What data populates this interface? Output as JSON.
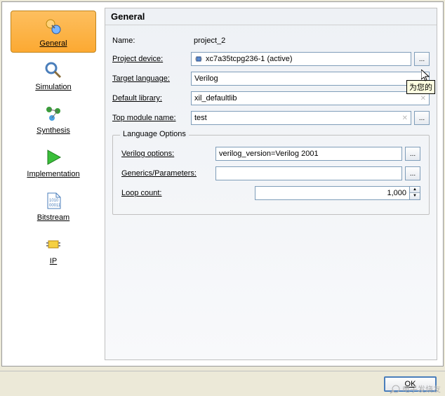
{
  "sidebar": {
    "items": [
      {
        "label": "General"
      },
      {
        "label": "Simulation"
      },
      {
        "label": "Synthesis"
      },
      {
        "label": "Implementation"
      },
      {
        "label": "Bitstream"
      },
      {
        "label": "IP"
      }
    ]
  },
  "panel": {
    "title": "General",
    "name_label": "Name:",
    "name_value": "project_2",
    "device_label": "Project device:",
    "device_value": "xc7a35tcpg236-1 (active)",
    "target_label": "Target language:",
    "target_value": "Verilog",
    "lib_label": "Default library:",
    "lib_value": "xil_defaultlib",
    "top_label": "Top module name:",
    "top_value": "test",
    "lang_options_legend": "Language Options",
    "verilog_opts_label": "Verilog options:",
    "verilog_opts_value": "verilog_version=Verilog 2001",
    "generics_label": "Generics/Parameters:",
    "generics_value": "",
    "loop_label": "Loop count:",
    "loop_value": "1,000",
    "ellipsis": "..."
  },
  "footer": {
    "ok": "OK"
  },
  "tooltip": "为您的",
  "watermark": "电子发烧友"
}
